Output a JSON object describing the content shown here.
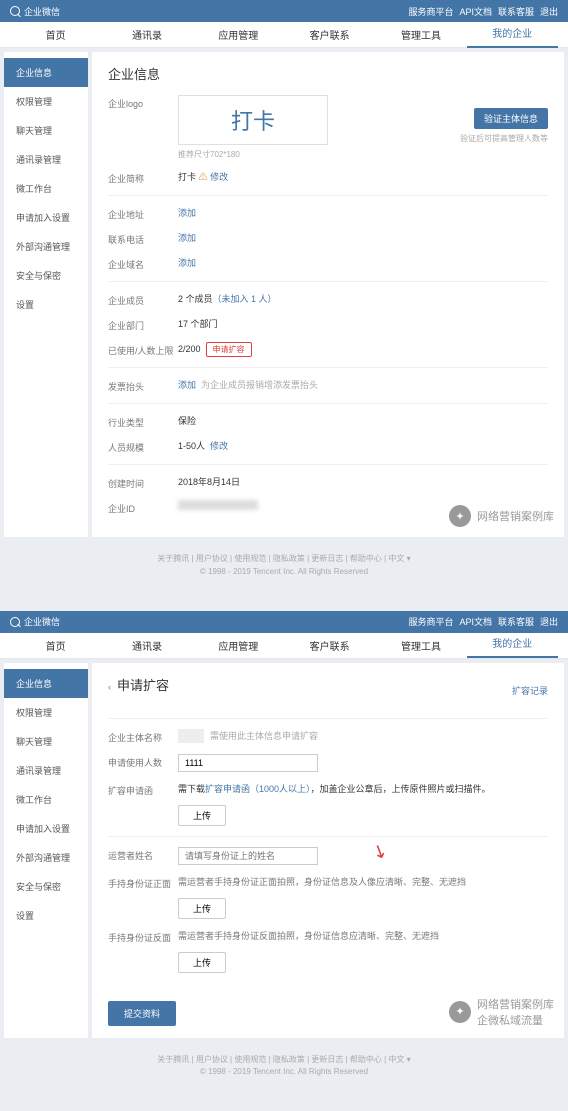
{
  "brand": "企业微信",
  "topLinks": [
    "服务商平台",
    "API文档",
    "联系客服",
    "退出"
  ],
  "nav": [
    "首页",
    "通讯录",
    "应用管理",
    "客户联系",
    "管理工具",
    "我的企业"
  ],
  "sidebar": [
    "企业信息",
    "权限管理",
    "聊天管理",
    "通讯录管理",
    "微工作台",
    "申请加入设置",
    "外部沟通管理",
    "安全与保密",
    "设置"
  ],
  "panel1": {
    "title": "企业信息",
    "logoLabel": "企业logo",
    "logoText": "打卡",
    "logoHint": "推荐尺寸702*180",
    "verifyBtn": "验证主体信息",
    "verifyHint": "验证后可提高管理人数等",
    "abbr": {
      "label": "企业简称",
      "value": "打卡",
      "change": "修改"
    },
    "addr": {
      "label": "企业地址",
      "value": "添加"
    },
    "phone": {
      "label": "联系电话",
      "value": "添加"
    },
    "domain": {
      "label": "企业域名",
      "value": "添加"
    },
    "members": {
      "label": "企业成员",
      "value": "2 个成员",
      "join": "（未加入 1 人）"
    },
    "depts": {
      "label": "企业部门",
      "value": "17 个部门"
    },
    "limit": {
      "label": "已使用/人数上限",
      "value": "2/200",
      "btn": "申请扩容"
    },
    "invoice": {
      "label": "发票抬头",
      "value": "添加",
      "hint": "为企业成员报销增添发票抬头"
    },
    "industry": {
      "label": "行业类型",
      "value": "保险"
    },
    "scale": {
      "label": "人员规模",
      "value": "1-50人",
      "change": "修改"
    },
    "created": {
      "label": "创建时间",
      "value": "2018年8月14日"
    },
    "corpId": {
      "label": "企业ID"
    }
  },
  "footer": {
    "links": "关于腾讯 | 用户协议 | 使用规范 | 隐私政策 | 更新日志 | 帮助中心 | 中文 ▾",
    "copyright": "© 1998 - 2019 Tencent Inc. All Rights Reserved"
  },
  "panel2": {
    "back": "‹",
    "title": "申请扩容",
    "records": "扩容记录",
    "subject": {
      "label": "企业主体名称",
      "hint": "需使用此主体信息申请扩容"
    },
    "count": {
      "label": "申请使用人数",
      "value": "1111"
    },
    "letter": {
      "label": "扩容申请函",
      "pre": "需下载",
      "link": "扩容申请函（1000人以上）",
      "post": "，加盖企业公章后，上传原件照片或扫描件。",
      "upload": "上传"
    },
    "operator": {
      "label": "运营者姓名",
      "placeholder": "请填写身份证上的姓名"
    },
    "idFront": {
      "label": "手持身份证正面",
      "hint": "需运营者手持身份证正面拍照，身份证信息及人像应清晰、完整、无遮挡",
      "upload": "上传"
    },
    "idBack": {
      "label": "手持身份证反面",
      "hint": "需运营者手持身份证反面拍照，身份证信息应清晰、完整、无遮挡",
      "upload": "上传"
    },
    "submit": "提交资料"
  },
  "watermarks": [
    "网络营销案例库",
    "网络营销案例库",
    "企微私域流量"
  ]
}
